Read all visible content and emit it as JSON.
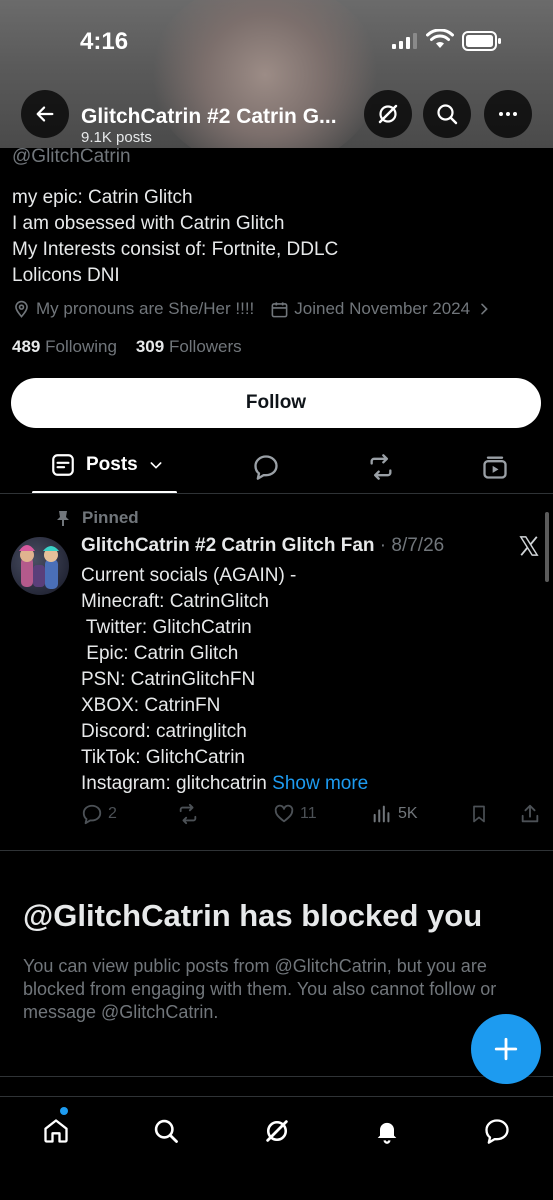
{
  "status_bar": {
    "time": "4:16"
  },
  "header": {
    "title": "GlitchCatrin #2 Catrin G...",
    "post_count": "9.1K posts"
  },
  "profile": {
    "handle": "@GlitchCatrin",
    "bio": [
      "my epic: Catrin Glitch",
      "I am obsessed with Catrin Glitch",
      "My Interests consist of: Fortnite, DDLC",
      "Lolicons DNI"
    ],
    "pronouns": "My pronouns are She/Her !!!!",
    "joined": "Joined November 2024",
    "following_count": "489",
    "following_label": "Following",
    "followers_count": "309",
    "followers_label": "Followers",
    "follow_button": "Follow"
  },
  "tabs": {
    "posts_label": "Posts"
  },
  "pinned_post": {
    "pinned_label": "Pinned",
    "author": "GlitchCatrin #2 Catrin Glitch Fan",
    "date": "· 8/7/26",
    "body_lines": [
      "Current socials (AGAIN) -",
      "Minecraft: CatrinGlitch",
      " Twitter: GlitchCatrin",
      " Epic: Catrin Glitch",
      "PSN: CatrinGlitchFN",
      "XBOX: CatrinFN",
      "Discord: catringlitch",
      "TikTok: GlitchCatrin",
      "Instagram: glitchcatrin"
    ],
    "show_more": "Show more",
    "replies": "2",
    "likes": "11",
    "views": "5K"
  },
  "blocked": {
    "title": "@GlitchCatrin has blocked you",
    "message": "You can view public posts from @GlitchCatrin, but you are blocked from engaging with them. You also cannot follow or message @GlitchCatrin."
  },
  "colors": {
    "accent": "#1d9bf0",
    "background": "#000000",
    "muted": "#71767b"
  },
  "icons": [
    "back-arrow-icon",
    "grok-icon",
    "search-icon",
    "more-icon",
    "location-icon",
    "calendar-icon",
    "chevron-right-icon",
    "posts-icon",
    "chevron-down-icon",
    "reply-icon",
    "retweet-icon",
    "media-icon",
    "pin-icon",
    "x-logo-icon",
    "like-icon",
    "views-icon",
    "bookmark-icon",
    "share-icon",
    "compose-icon",
    "home-icon",
    "bell-icon",
    "messages-icon"
  ]
}
